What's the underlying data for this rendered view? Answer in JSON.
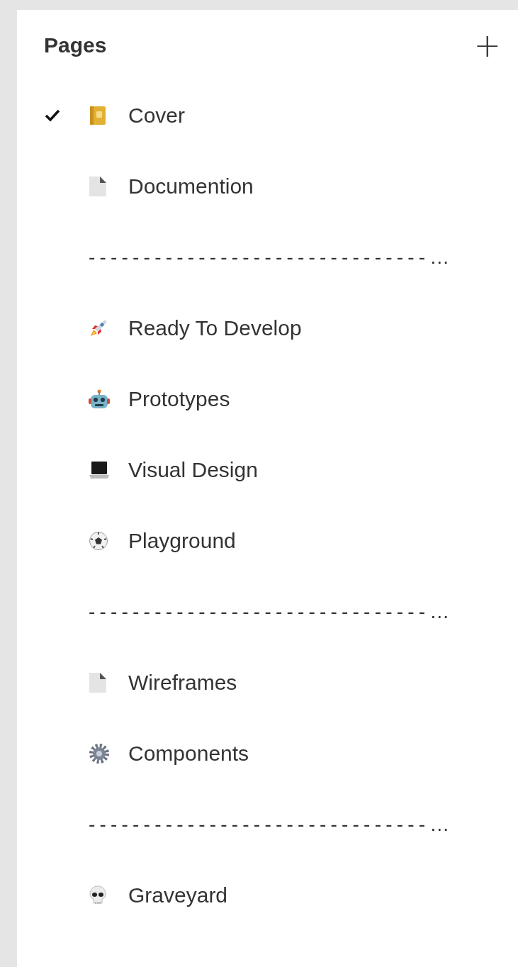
{
  "panel": {
    "title": "Pages",
    "add_button": "+"
  },
  "pages": [
    {
      "kind": "page",
      "label": "Cover",
      "selected": true
    },
    {
      "kind": "page",
      "label": "Documention",
      "selected": false
    },
    {
      "kind": "separator",
      "label": "-------------------------------…"
    },
    {
      "kind": "page",
      "label": "Ready To Develop",
      "selected": false
    },
    {
      "kind": "page",
      "label": "Prototypes",
      "selected": false
    },
    {
      "kind": "page",
      "label": "Visual Design",
      "selected": false
    },
    {
      "kind": "page",
      "label": "Playground",
      "selected": false
    },
    {
      "kind": "separator",
      "label": "-------------------------------…"
    },
    {
      "kind": "page",
      "label": "Wireframes",
      "selected": false
    },
    {
      "kind": "page",
      "label": "Components",
      "selected": false
    },
    {
      "kind": "separator",
      "label": "-------------------------------…"
    },
    {
      "kind": "page",
      "label": "Graveyard",
      "selected": false
    }
  ]
}
